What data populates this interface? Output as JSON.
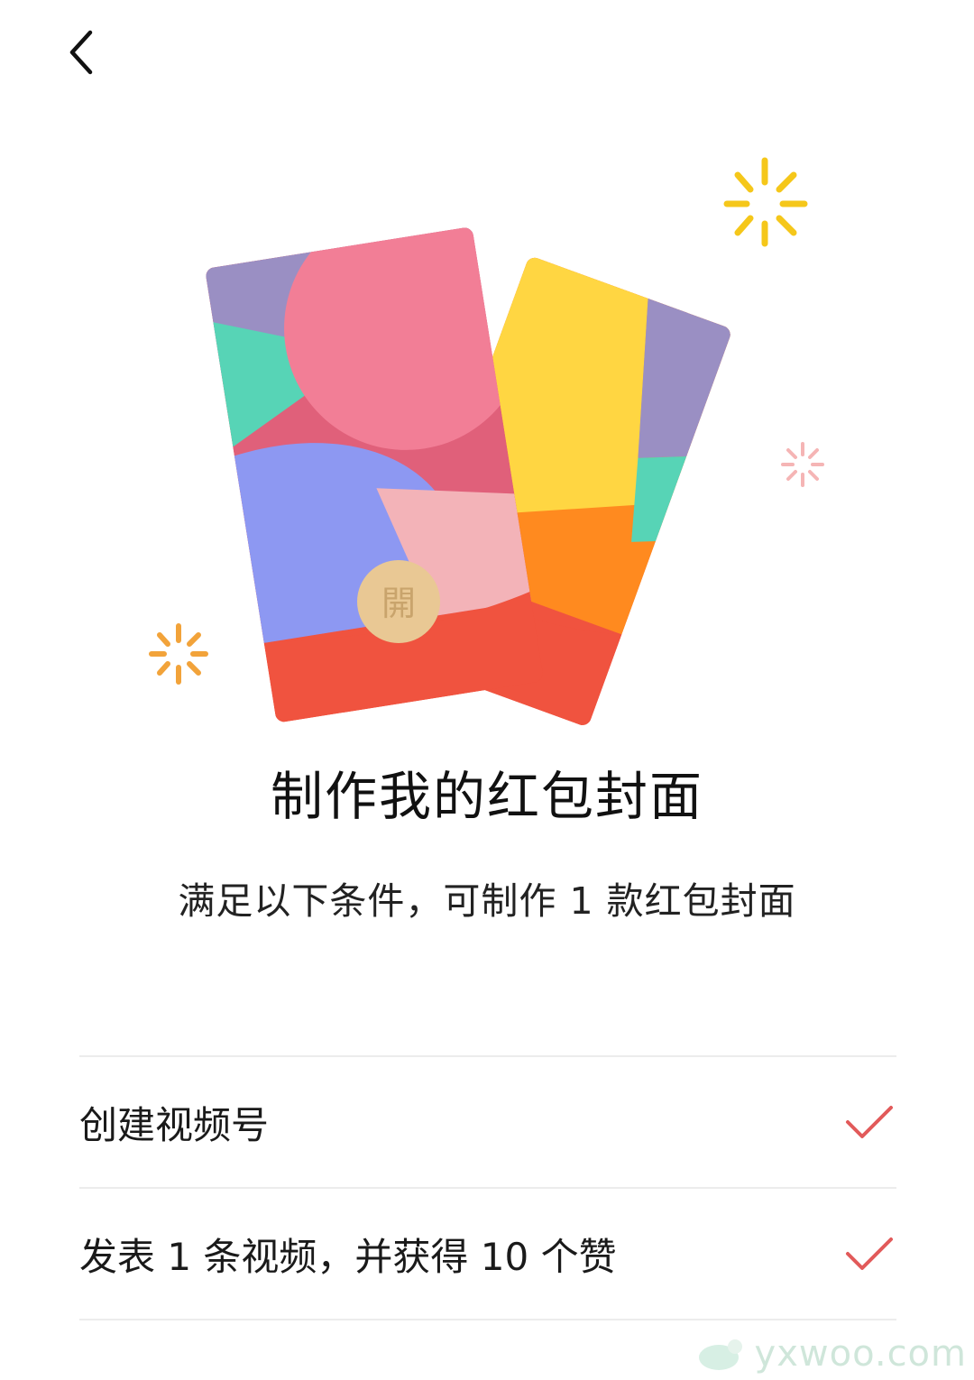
{
  "nav": {
    "back_icon": "chevron-left-icon"
  },
  "illustration": {
    "open_char": "開",
    "colors": {
      "red": "#F0533F",
      "pink": "#F27E96",
      "purple": "#9A8FC3",
      "green": "#57D4B6",
      "blue": "#8D98F2",
      "yellow": "#FFD642",
      "orange": "#FF8A1F",
      "coin": "#E9C894",
      "sparkle_yellow": "#F5C71A",
      "sparkle_orange": "#F2A33A",
      "sparkle_pink": "#F5B5B5"
    }
  },
  "main": {
    "title": "制作我的红包封面",
    "subtitle": "满足以下条件，可制作 1 款红包封面"
  },
  "requirements": [
    {
      "label": "创建视频号",
      "icon": "check-icon",
      "check_color": "#E25A5A"
    },
    {
      "label": "发表 1 条视频，并获得 10 个赞",
      "icon": "check-icon",
      "check_color": "#E25A5A"
    }
  ],
  "watermark": {
    "text": "yxwoo.com"
  }
}
